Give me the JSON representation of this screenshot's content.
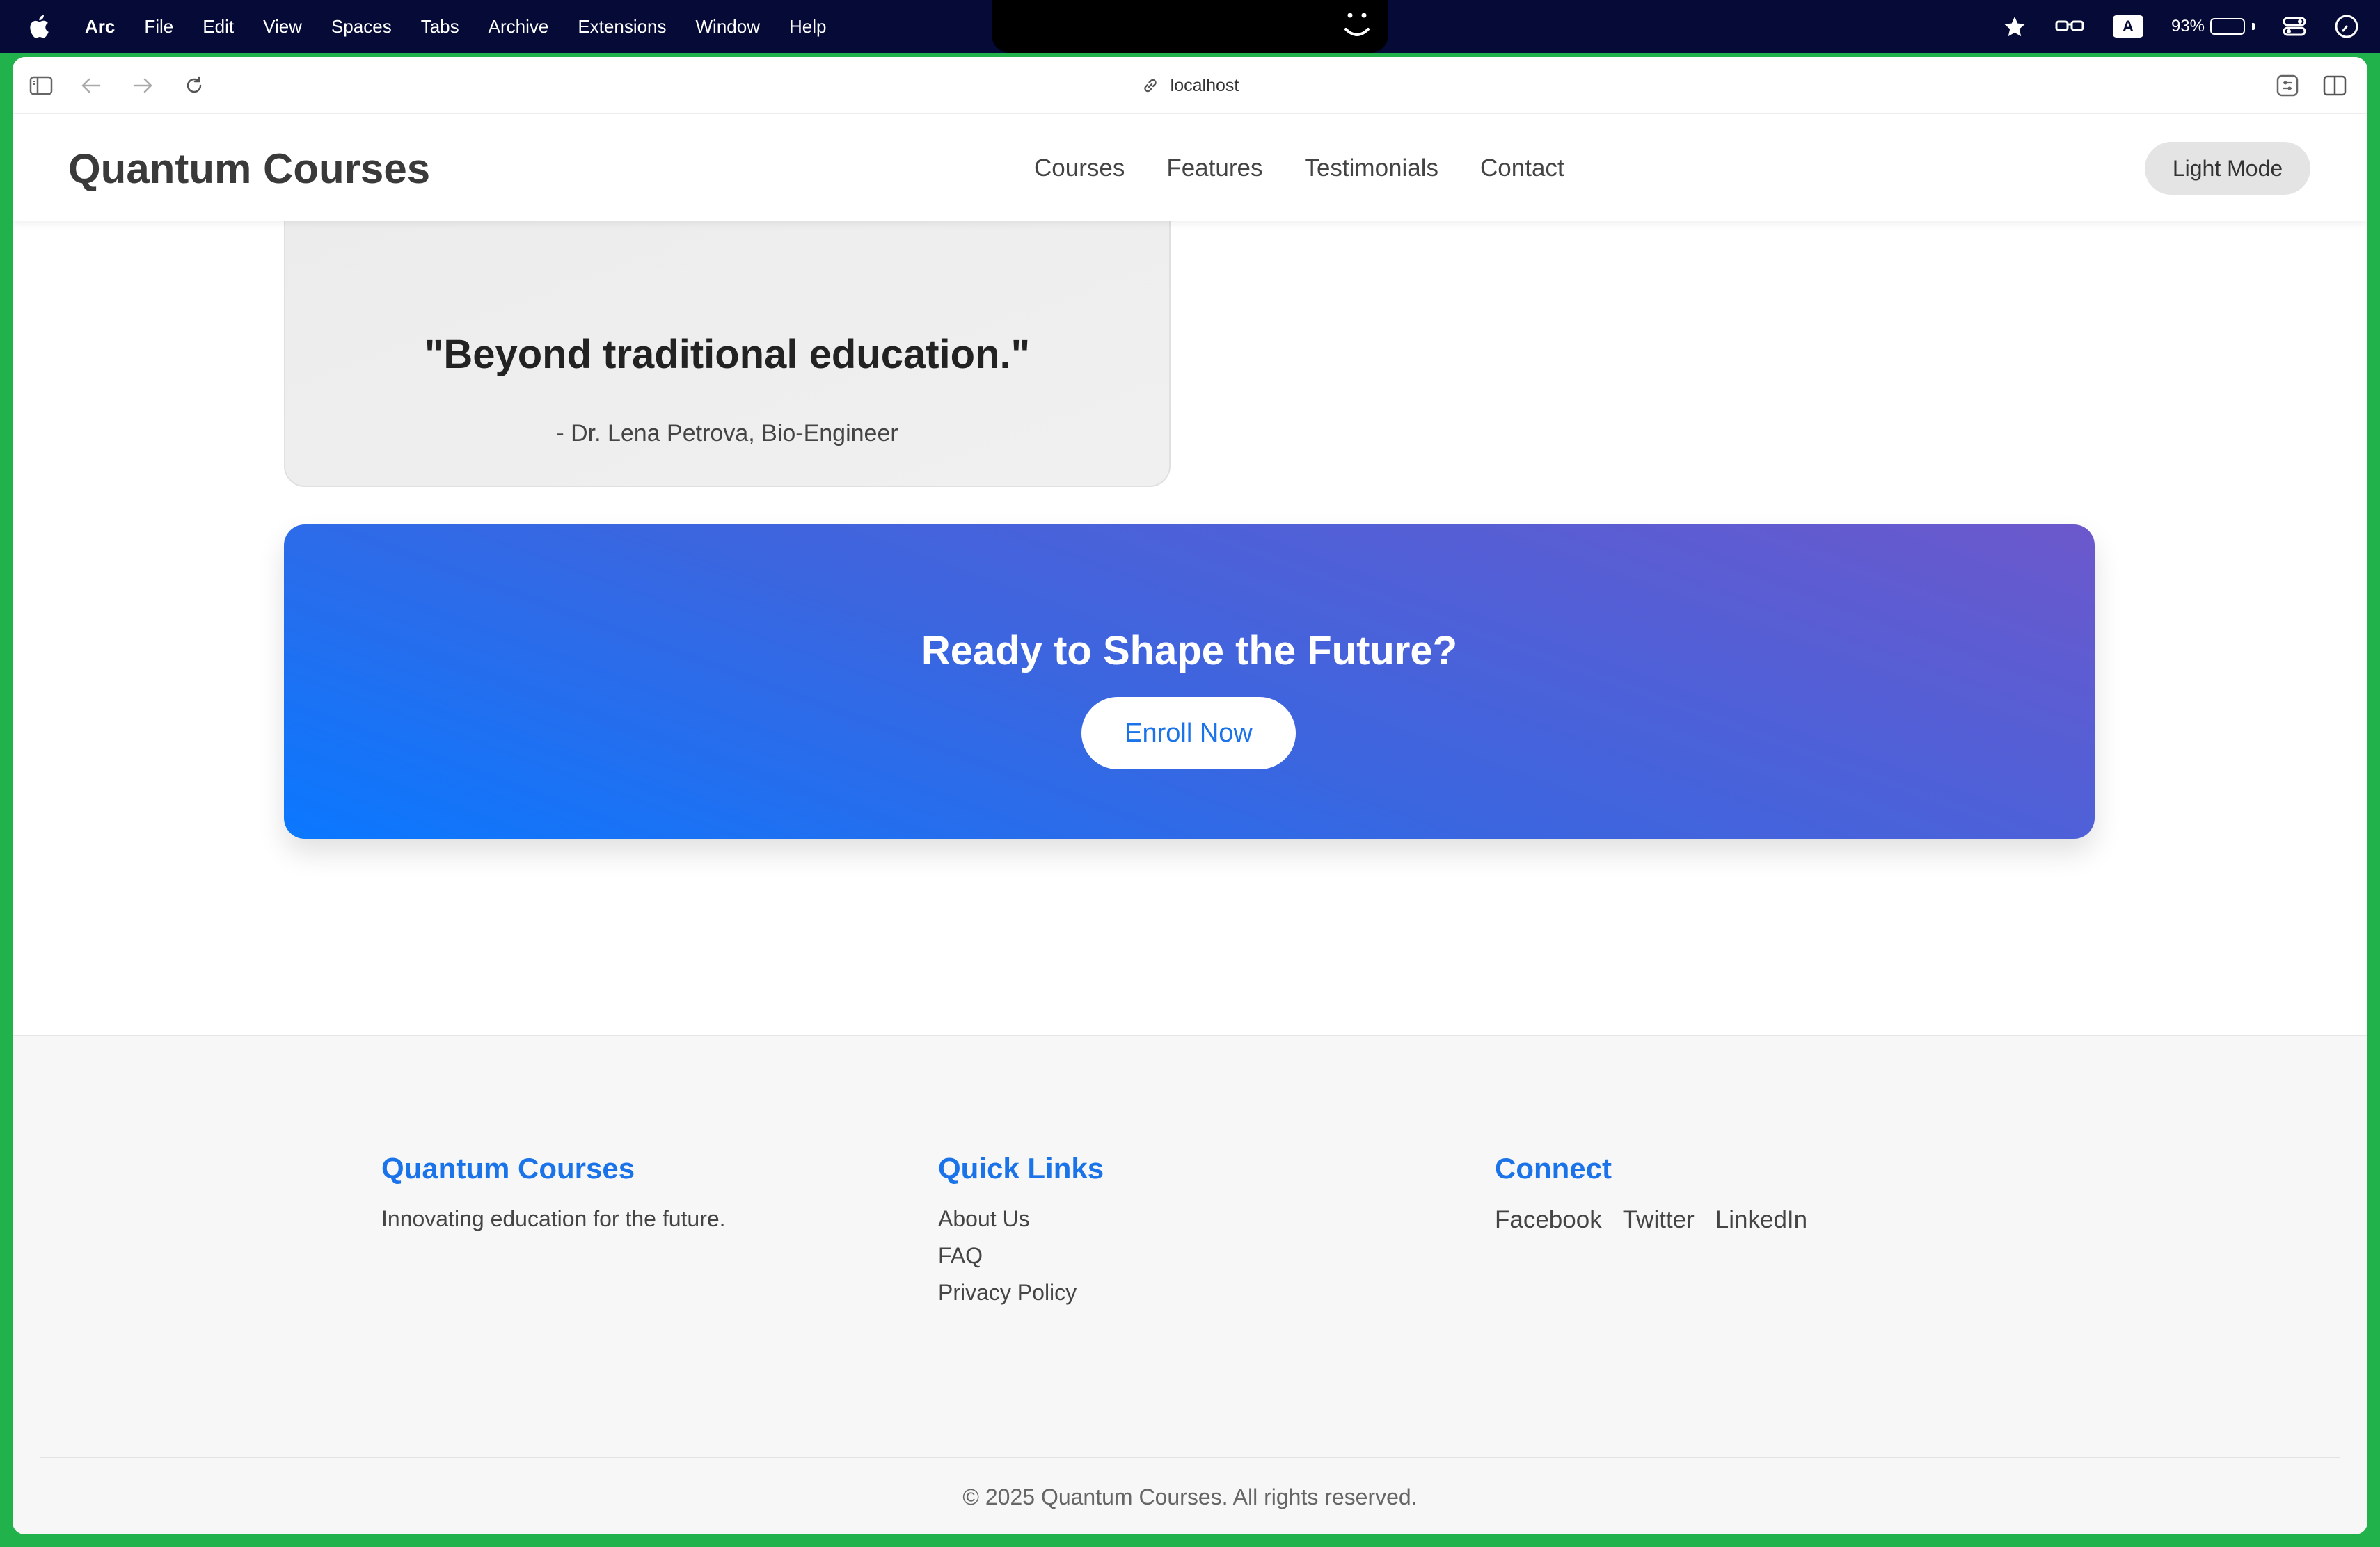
{
  "menubar": {
    "app_name": "Arc",
    "items": [
      "File",
      "Edit",
      "View",
      "Spaces",
      "Tabs",
      "Archive",
      "Extensions",
      "Window",
      "Help"
    ],
    "battery_percent": "93%",
    "battery_level": 0.93,
    "keyboard_input": "A"
  },
  "browser": {
    "url": "localhost"
  },
  "header": {
    "logo": "Quantum Courses",
    "nav": [
      "Courses",
      "Features",
      "Testimonials",
      "Contact"
    ],
    "mode_button": "Light Mode"
  },
  "testimonial": {
    "quote": "\"Beyond traditional education.\"",
    "author": "- Dr. Lena Petrova, Bio-Engineer"
  },
  "cta": {
    "title": "Ready to Shape the Future?",
    "button": "Enroll Now"
  },
  "footer": {
    "brand": {
      "title": "Quantum Courses",
      "text": "Innovating education for the future."
    },
    "quick_links": {
      "title": "Quick Links",
      "items": [
        "About Us",
        "FAQ",
        "Privacy Policy"
      ]
    },
    "connect": {
      "title": "Connect",
      "items": [
        "Facebook",
        "Twitter",
        "LinkedIn"
      ]
    },
    "copyright": "© 2025 Quantum Courses. All rights reserved."
  },
  "colors": {
    "accent": "#1a73e8",
    "cta_gradient_start": "#0a78ff",
    "cta_gradient_end": "#6c58cc",
    "window_border": "#22b24c",
    "menubar": "#050b36"
  }
}
